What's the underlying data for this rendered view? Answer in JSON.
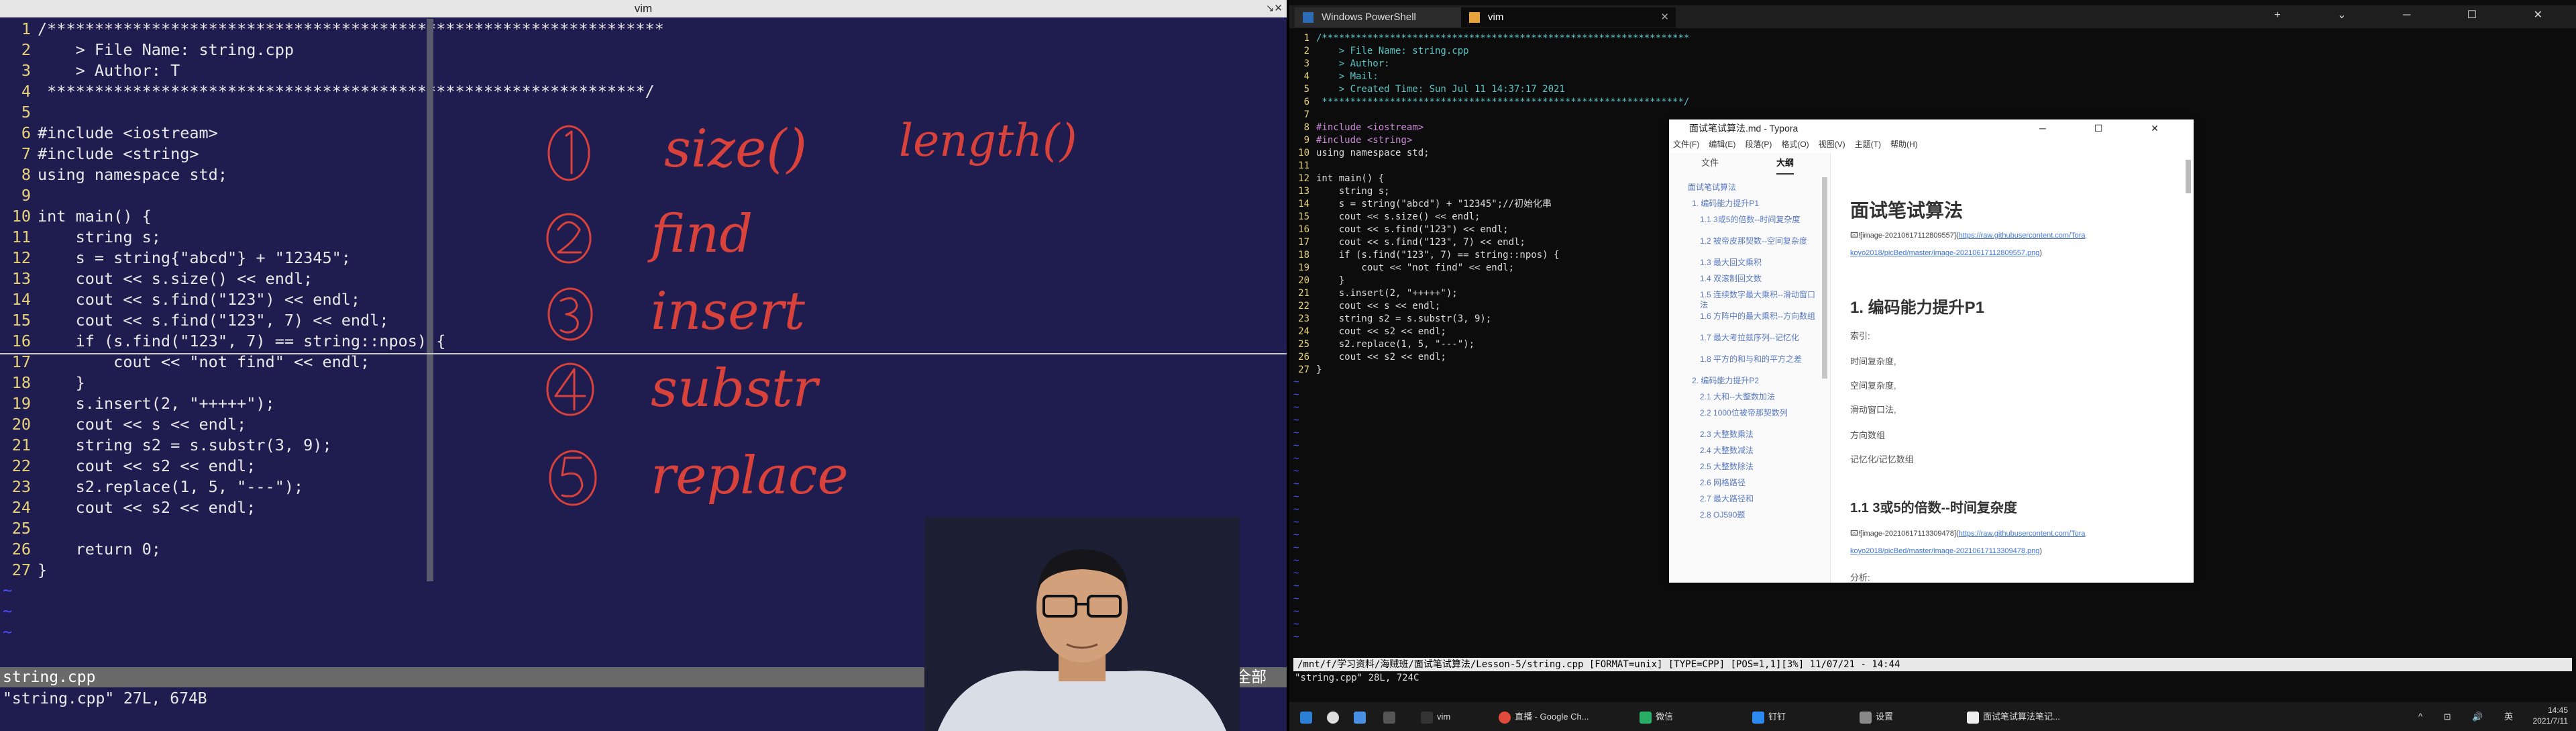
{
  "left": {
    "title": "vim",
    "window_controls": "↘✕",
    "lines": [
      {
        "n": "1",
        "t": "/*****************************************************************"
      },
      {
        "n": "2",
        "t": "    > File Name: string.cpp"
      },
      {
        "n": "3",
        "t": "    > Author: T"
      },
      {
        "n": "4",
        "t": " ***************************************************************/"
      },
      {
        "n": "5",
        "t": ""
      },
      {
        "n": "6",
        "t": "#include <iostream>"
      },
      {
        "n": "7",
        "t": "#include <string>"
      },
      {
        "n": "8",
        "t": "using namespace std;"
      },
      {
        "n": "9",
        "t": ""
      },
      {
        "n": "10",
        "t": "int main() {"
      },
      {
        "n": "11",
        "t": "    string s;"
      },
      {
        "n": "12",
        "t": "    s = string{\"abcd\"} + \"12345\";"
      },
      {
        "n": "13",
        "t": "    cout << s.size() << endl;"
      },
      {
        "n": "14",
        "t": "    cout << s.find(\"123\") << endl;"
      },
      {
        "n": "15",
        "t": "    cout << s.find(\"123\", 7) << endl;"
      },
      {
        "n": "16",
        "t": "    if (s.find(\"123\", 7) == string::npos) {"
      },
      {
        "n": "17",
        "t": "        cout << \"not find\" << endl;"
      },
      {
        "n": "18",
        "t": "    }"
      },
      {
        "n": "19",
        "t": "    s.insert(2, \"+++++\");"
      },
      {
        "n": "20",
        "t": "    cout << s << endl;"
      },
      {
        "n": "21",
        "t": "    string s2 = s.substr(3, 9);"
      },
      {
        "n": "22",
        "t": "    cout << s2 << endl;"
      },
      {
        "n": "23",
        "t": "    s2.replace(1, 5, \"---\");"
      },
      {
        "n": "24",
        "t": "    cout << s2 << endl;"
      },
      {
        "n": "25",
        "t": ""
      },
      {
        "n": "26",
        "t": "    return 0;"
      },
      {
        "n": "27",
        "t": "}"
      }
    ],
    "tilde": "~",
    "status_file": "string.cpp",
    "status_pos": "全部",
    "message": "\"string.cpp\" 27L, 674B",
    "annotations": [
      "① size()   length()",
      "② find",
      "③ insert",
      "④ substr",
      "⑤ replace"
    ]
  },
  "right": {
    "tabs": [
      {
        "label": "Windows PowerShell"
      },
      {
        "label": "vim"
      }
    ],
    "tab_controls": "+ ⌄ ─ ☐ ✕",
    "lines": [
      {
        "n": "1",
        "t": "/*****************************************************************"
      },
      {
        "n": "2",
        "t": "    > File Name: string.cpp"
      },
      {
        "n": "3",
        "t": "    > Author:"
      },
      {
        "n": "4",
        "t": "    > Mail:"
      },
      {
        "n": "5",
        "t": "    > Created Time: Sun Jul 11 14:37:17 2021"
      },
      {
        "n": "6",
        "t": " ****************************************************************/"
      },
      {
        "n": "7",
        "t": ""
      },
      {
        "n": "8",
        "t": "#include <iostream>"
      },
      {
        "n": "9",
        "t": "#include <string>"
      },
      {
        "n": "10",
        "t": "using namespace std;"
      },
      {
        "n": "11",
        "t": ""
      },
      {
        "n": "12",
        "t": "int main() {"
      },
      {
        "n": "13",
        "t": "    string s;"
      },
      {
        "n": "14",
        "t": "    s = string(\"abcd\") + \"12345\";//初始化串"
      },
      {
        "n": "15",
        "t": "    cout << s.size() << endl;"
      },
      {
        "n": "16",
        "t": "    cout << s.find(\"123\") << endl;"
      },
      {
        "n": "17",
        "t": "    cout << s.find(\"123\", 7) << endl;"
      },
      {
        "n": "18",
        "t": "    if (s.find(\"123\", 7) == string::npos) {"
      },
      {
        "n": "19",
        "t": "        cout << \"not find\" << endl;"
      },
      {
        "n": "20",
        "t": "    }"
      },
      {
        "n": "21",
        "t": "    s.insert(2, \"+++++\");"
      },
      {
        "n": "22",
        "t": "    cout << s << endl;"
      },
      {
        "n": "23",
        "t": "    string s2 = s.substr(3, 9);"
      },
      {
        "n": "24",
        "t": "    cout << s2 << endl;"
      },
      {
        "n": "25",
        "t": "    s2.replace(1, 5, \"---\");"
      },
      {
        "n": "26",
        "t": "    cout << s2 << endl;"
      },
      {
        "n": "27",
        "t": "}"
      }
    ],
    "tilde": "~",
    "status": "/mnt/f/学习资料/海贼班/面试笔试算法/Lesson-5/string.cpp [FORMAT=unix] [TYPE=CPP] [POS=1,1][3%] 11/07/21 - 14:44",
    "message": "\"string.cpp\" 28L, 724C"
  },
  "typora": {
    "title": "面试笔试算法.md - Typora",
    "controls": "─ ☐ ✕",
    "menu": [
      "文件(F)",
      "编辑(E)",
      "段落(P)",
      "格式(O)",
      "视图(V)",
      "主题(T)",
      "帮助(H)"
    ],
    "side_tabs": {
      "files": "文件",
      "outline": "大纲"
    },
    "outline": [
      "面试笔试算法",
      "1. 编码能力提升P1",
      "1.1 3或5的倍数--时间复杂度",
      "1.2 被帝皮那契数--空间复杂度",
      "1.3 最大回文乘积",
      "1.4 双滚制回文数",
      "1.5 连续数字最大乘积--滑动窗口法",
      "1.6 方阵中的最大乘积--方向数组",
      "1.7 最大考拉兹序列--记忆化",
      "1.8 平方的和与和的平方之差",
      "2. 编码能力提升P2",
      "2.1 大和--大整数加法",
      "2.2 1000位被帝那契数列",
      "2.3 大整数乘法",
      "2.4 大整数减法",
      "2.5 大整数除法",
      "2.6 网格路径",
      "2.7 最大路径和",
      "2.8 OJ590题"
    ],
    "doc": {
      "h1": "面试笔试算法",
      "img1_alt": "![image-20210617112809557](",
      "img1_url": "https://raw.githubusercontent.com/Tora koyo2018/picBed/master/image-20210617112809557.png",
      "img1_tail": ")",
      "h2": "1. 编码能力提升P1",
      "items": [
        "索引:",
        "时间复杂度,",
        "空间复杂度,",
        "滑动窗口法,",
        "方向数组",
        "记忆化/记忆数组"
      ],
      "h3": "1.1 3或5的倍数--时间复杂度",
      "img2_alt": "![image-20210617113309478](",
      "img2_url": "https://raw.githubusercontent.com/Tora koyo2018/picBed/master/image-20210617113309478.png",
      "img2_tail": ")",
      "tail_item": "分析:"
    }
  },
  "taskbar": {
    "items": [
      {
        "label": ""
      },
      {
        "label": ""
      },
      {
        "label": ""
      },
      {
        "label": "vim"
      },
      {
        "label": "直播 - Google Ch..."
      },
      {
        "label": "微信"
      },
      {
        "label": "钉钉"
      },
      {
        "label": "设置"
      },
      {
        "label": "面试笔试算法笔记..."
      }
    ],
    "tray": "^ ⊡ 🔊 英",
    "time": "14:45",
    "date": "2021/7/11"
  }
}
